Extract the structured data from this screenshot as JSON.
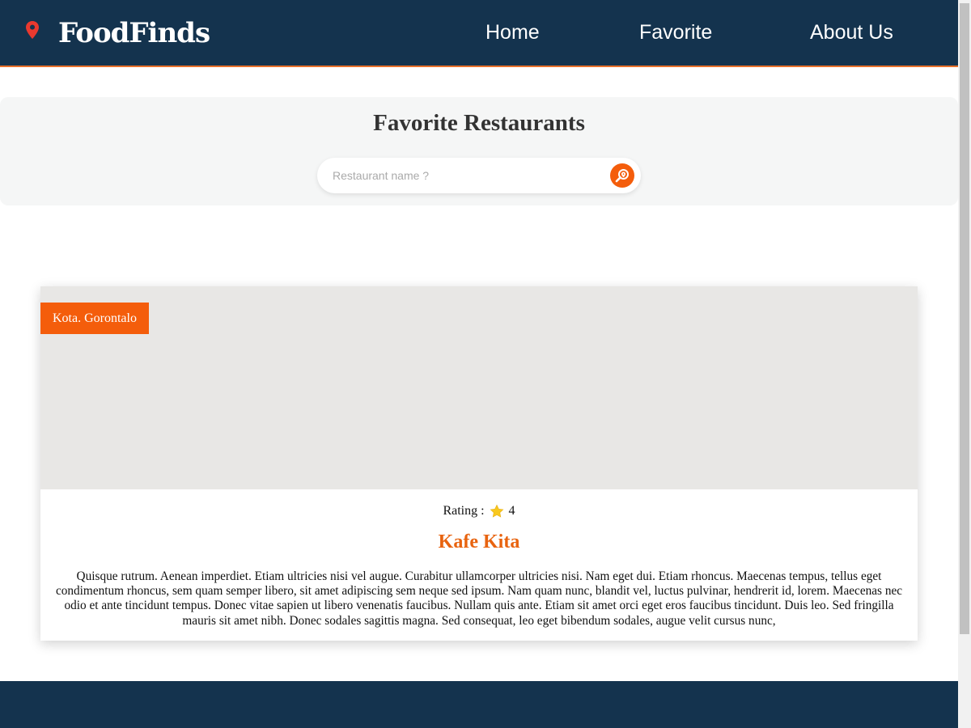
{
  "header": {
    "brand": "FoodFinds",
    "nav": [
      {
        "label": "Home"
      },
      {
        "label": "Favorite"
      },
      {
        "label": "About Us"
      }
    ]
  },
  "hero": {
    "title": "Favorite Restaurants",
    "search_placeholder": "Restaurant name ?"
  },
  "restaurants": [
    {
      "city": "Kota. Gorontalo",
      "rating_label": "Rating :",
      "rating": "4",
      "name": "Kafe Kita",
      "description": "Quisque rutrum. Aenean imperdiet. Etiam ultricies nisi vel augue. Curabitur ullamcorper ultricies nisi. Nam eget dui. Etiam rhoncus. Maecenas tempus, tellus eget condimentum rhoncus, sem quam semper libero, sit amet adipiscing sem neque sed ipsum. Nam quam nunc, blandit vel, luctus pulvinar, hendrerit id, lorem. Maecenas nec odio et ante tincidunt tempus. Donec vitae sapien ut libero venenatis faucibus. Nullam quis ante. Etiam sit amet orci eget eros faucibus tincidunt. Duis leo. Sed fringilla mauris sit amet nibh. Donec sodales sagittis magna. Sed consequat, leo eget bibendum sodales, augue velit cursus nunc,"
    }
  ],
  "colors": {
    "header_bg": "#14334e",
    "accent": "#f45d0b",
    "title_orange": "#e8630f",
    "star": "#f8c81e"
  },
  "icons": {
    "logo": "map-pin-icon",
    "search": "search-location-icon",
    "rating": "star-icon"
  }
}
